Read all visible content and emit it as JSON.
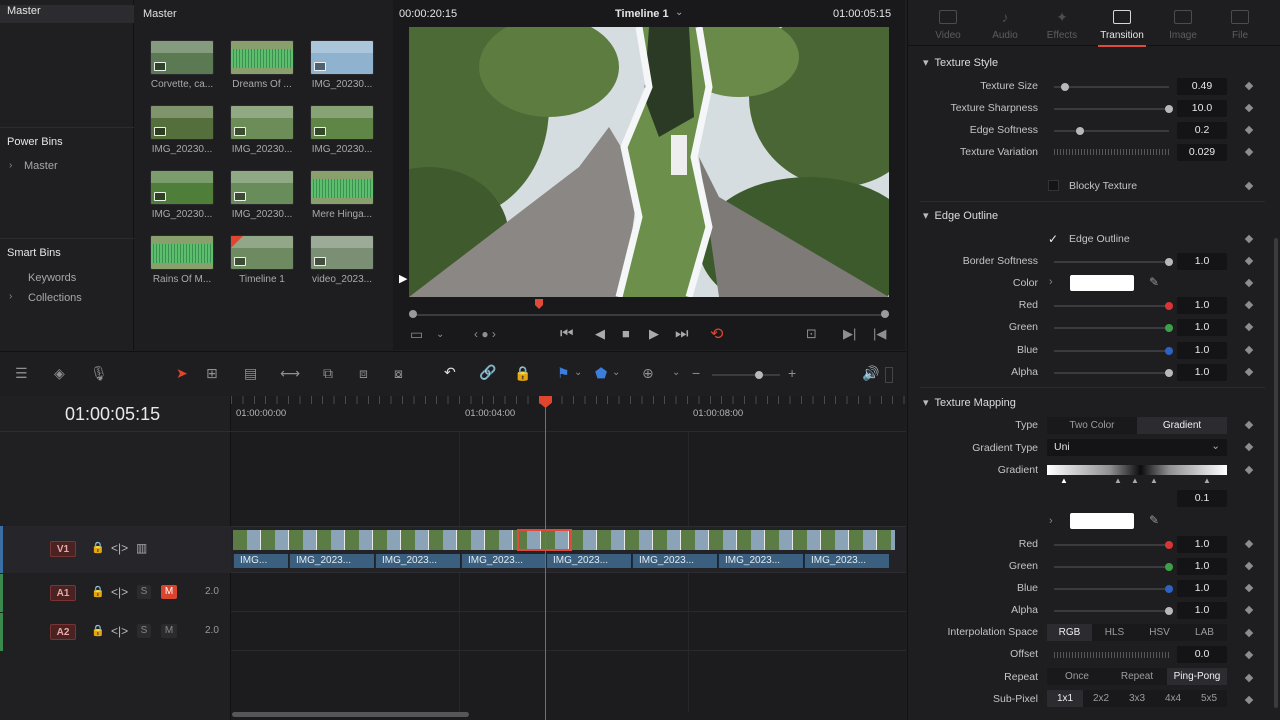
{
  "bins": {
    "master": "Master",
    "power_bins": "Power Bins",
    "power_master": "Master",
    "smart_bins": "Smart Bins",
    "keywords": "Keywords",
    "collections": "Collections"
  },
  "media_pool": {
    "title": "Master",
    "clips": [
      {
        "label": "Corvette, ca...",
        "kind": "video",
        "color": "#5b7a53"
      },
      {
        "label": "Dreams Of ...",
        "kind": "audio",
        "color": "#4f8a58"
      },
      {
        "label": "IMG_20230...",
        "kind": "image",
        "color": "#8fb3cf"
      },
      {
        "label": "IMG_20230...",
        "kind": "image",
        "color": "#556f3c"
      },
      {
        "label": "IMG_20230...",
        "kind": "image",
        "color": "#6d8d58"
      },
      {
        "label": "IMG_20230...",
        "kind": "image",
        "color": "#5f8547"
      },
      {
        "label": "IMG_20230...",
        "kind": "image",
        "color": "#4f7d3a"
      },
      {
        "label": "IMG_20230...",
        "kind": "image",
        "color": "#698d5a"
      },
      {
        "label": "Mere Hinga...",
        "kind": "audio",
        "color": "#4f8a58"
      },
      {
        "label": "Rains Of M...",
        "kind": "audio",
        "color": "#4f8a58"
      },
      {
        "label": "Timeline 1",
        "kind": "timeline",
        "color": "#6e8a60"
      },
      {
        "label": "video_2023...",
        "kind": "video",
        "color": "#7b8f74"
      }
    ]
  },
  "viewer": {
    "source_tc": "00:00:20:15",
    "timeline_name": "Timeline 1",
    "record_tc": "01:00:05:15"
  },
  "inspector": {
    "tabs": [
      "Video",
      "Audio",
      "Effects",
      "Transition",
      "Image",
      "File"
    ],
    "active_tab": "Transition",
    "texture_style": {
      "title": "Texture Style",
      "params": [
        {
          "label": "Texture Size",
          "value": "0.49",
          "pos": 0.06
        },
        {
          "label": "Texture Sharpness",
          "value": "10.0",
          "pos": 1.0
        },
        {
          "label": "Edge Softness",
          "value": "0.2",
          "pos": 0.2
        },
        {
          "label": "Texture Variation",
          "value": "0.029",
          "pos": null
        }
      ],
      "blocky_texture": "Blocky Texture"
    },
    "edge_outline": {
      "title": "Edge Outline",
      "checkbox": "Edge Outline",
      "border_softness": {
        "label": "Border Softness",
        "value": "1.0"
      },
      "color_label": "Color",
      "channels": [
        {
          "label": "Red",
          "value": "1.0",
          "color": "#d93535"
        },
        {
          "label": "Green",
          "value": "1.0",
          "color": "#3aa14a"
        },
        {
          "label": "Blue",
          "value": "1.0",
          "color": "#2d62c4"
        },
        {
          "label": "Alpha",
          "value": "1.0",
          "color": "#b8b8bb"
        }
      ]
    },
    "texture_mapping": {
      "title": "Texture Mapping",
      "type_label": "Type",
      "type_options": [
        "Two Color",
        "Gradient"
      ],
      "type_selected": "Gradient",
      "gradient_type_label": "Gradient Type",
      "gradient_type_value": "Uni",
      "gradient_label": "Gradient",
      "gradient_value": "0.1",
      "channels": [
        {
          "label": "Red",
          "value": "1.0",
          "color": "#d93535"
        },
        {
          "label": "Green",
          "value": "1.0",
          "color": "#3aa14a"
        },
        {
          "label": "Blue",
          "value": "1.0",
          "color": "#2d62c4"
        },
        {
          "label": "Alpha",
          "value": "1.0",
          "color": "#b8b8bb"
        }
      ],
      "interp_label": "Interpolation Space",
      "interp_options": [
        "RGB",
        "HLS",
        "HSV",
        "LAB"
      ],
      "interp_selected": "RGB",
      "offset_label": "Offset",
      "offset_value": "0.0",
      "repeat_label": "Repeat",
      "repeat_options": [
        "Once",
        "Repeat",
        "Ping-Pong"
      ],
      "repeat_selected": "Ping-Pong",
      "subpixel_label": "Sub-Pixel",
      "subpixel_options": [
        "1x1",
        "2x2",
        "3x3",
        "4x4",
        "5x5"
      ],
      "subpixel_selected": "1x1"
    }
  },
  "timeline": {
    "timecode": "01:00:05:15",
    "ruler": [
      "01:00:00:00",
      "01:00:04:00",
      "01:00:08:00"
    ],
    "tracks": [
      {
        "name": "V1",
        "type": "video"
      },
      {
        "name": "A1",
        "type": "audio",
        "level": "2.0",
        "solo": "S",
        "mute": "M",
        "muted": true
      },
      {
        "name": "A2",
        "type": "audio",
        "level": "2.0",
        "solo": "S",
        "mute": "M",
        "muted": false
      }
    ],
    "clips": [
      "IMG...",
      "IMG_2023...",
      "IMG_2023...",
      "IMG_2023...",
      "IMG_2023...",
      "IMG_2023...",
      "IMG_2023...",
      "IMG_2023..."
    ]
  }
}
